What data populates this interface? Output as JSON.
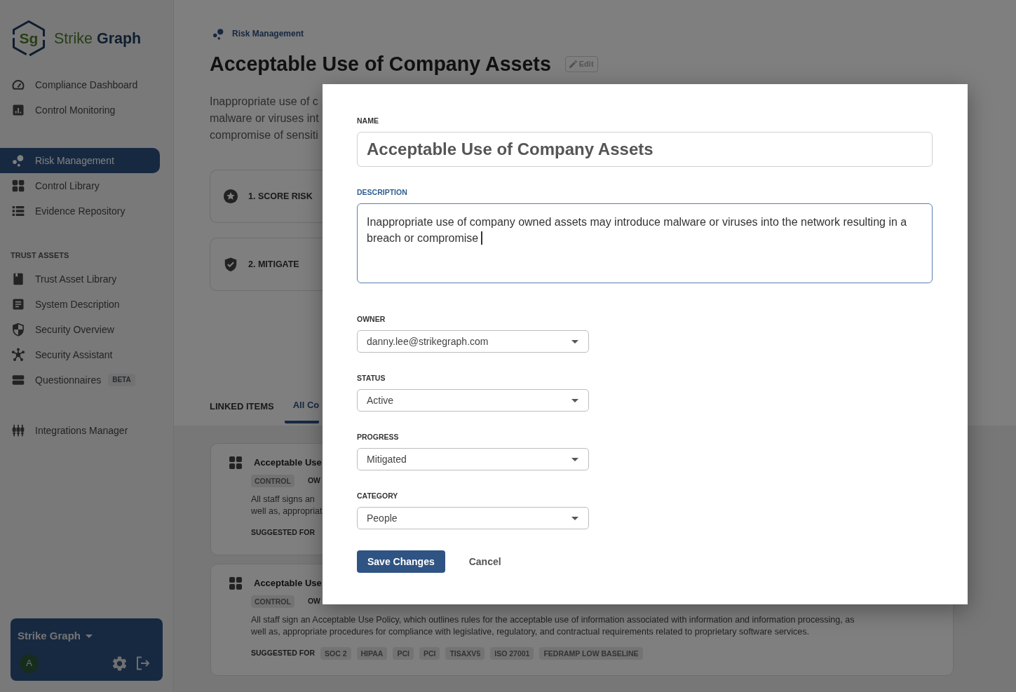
{
  "sidebar": {
    "brand": {
      "monogram": "Sg",
      "name": "Strike **Graph**"
    },
    "sections": [
      {
        "items": [
          {
            "label": "Compliance Dashboard",
            "selected": false
          },
          {
            "label": "Control Monitoring",
            "selected": false
          }
        ]
      },
      {
        "items": [
          {
            "label": "Risk Management",
            "selected": true
          },
          {
            "label": "Control Library",
            "selected": false
          },
          {
            "label": "Evidence Repository",
            "selected": false
          }
        ]
      },
      {
        "heading": "TRUST ASSETS",
        "items": [
          {
            "label": "Trust Asset Library",
            "selected": false
          },
          {
            "label": "System Description",
            "selected": false
          },
          {
            "label": "Security Overview",
            "selected": false
          },
          {
            "label": "Security Assistant",
            "selected": false
          },
          {
            "label": "Questionnaires",
            "badge": "BETA",
            "selected": false
          }
        ]
      },
      {
        "items": [
          {
            "label": "Integrations Manager",
            "selected": false
          }
        ]
      }
    ],
    "account": {
      "organization": "Strike Graph",
      "avatar": "A"
    }
  },
  "page": {
    "breadcrumb": "Risk Management",
    "title": "Acceptable Use of Company Assets",
    "edit_button": "Edit",
    "description_lines": [
      "Inappropriate use of c",
      "malware or viruses int",
      "compromise of sensiti"
    ],
    "steps": [
      {
        "label": "1. SCORE RISK"
      },
      {
        "label": "2. MITIGATE"
      }
    ],
    "linked_items": {
      "heading": "LINKED ITEMS",
      "tabs": [
        {
          "label": "All Co",
          "selected": true
        }
      ]
    },
    "cards": [
      {
        "title": "Acceptable Use",
        "type": "CONTROL",
        "owner_label": "OW",
        "description_lines": [
          "All staff signs an",
          "well as, appropriat"
        ],
        "suggested_label": "SUGGESTED FOR"
      },
      {
        "title": "Acceptable Use",
        "type": "CONTROL",
        "owner_label": "OW",
        "description": "All staff sign an Acceptable Use Policy, which outlines rules for the acceptable use of information associated with information and information processing, as well as, appropriate procedures for compliance with legislative, regulatory, and contractual requirements related to proprietary software services.",
        "suggested_label": "SUGGESTED FOR",
        "frameworks": [
          "SOC 2",
          "HIPAA",
          "PCI",
          "PCI",
          "TISAXV5",
          "ISO 27001",
          "FEDRAMP LOW BASELINE"
        ]
      }
    ]
  },
  "modal": {
    "fields": [
      {
        "kind": "title",
        "label": "NAME",
        "value": "Acceptable Use of Company Assets",
        "focused": false
      },
      {
        "kind": "textarea",
        "label": "DESCRIPTION",
        "value": "Inappropriate use of company owned assets may introduce malware or viruses into the network resulting in a breach or compromise",
        "focused": true
      },
      {
        "kind": "select",
        "label": "OWNER",
        "value": "danny.lee@strikegraph.com",
        "focused": false
      },
      {
        "kind": "select",
        "label": "STATUS",
        "value": "Active",
        "focused": false
      },
      {
        "kind": "select",
        "label": "PROGRESS",
        "value": "Mitigated",
        "focused": false
      },
      {
        "kind": "select",
        "label": "CATEGORY",
        "value": "People",
        "focused": false
      }
    ],
    "buttons": [
      {
        "kind": "primary",
        "label": "Save Changes"
      },
      {
        "kind": "text",
        "label": "Cancel"
      }
    ]
  }
}
